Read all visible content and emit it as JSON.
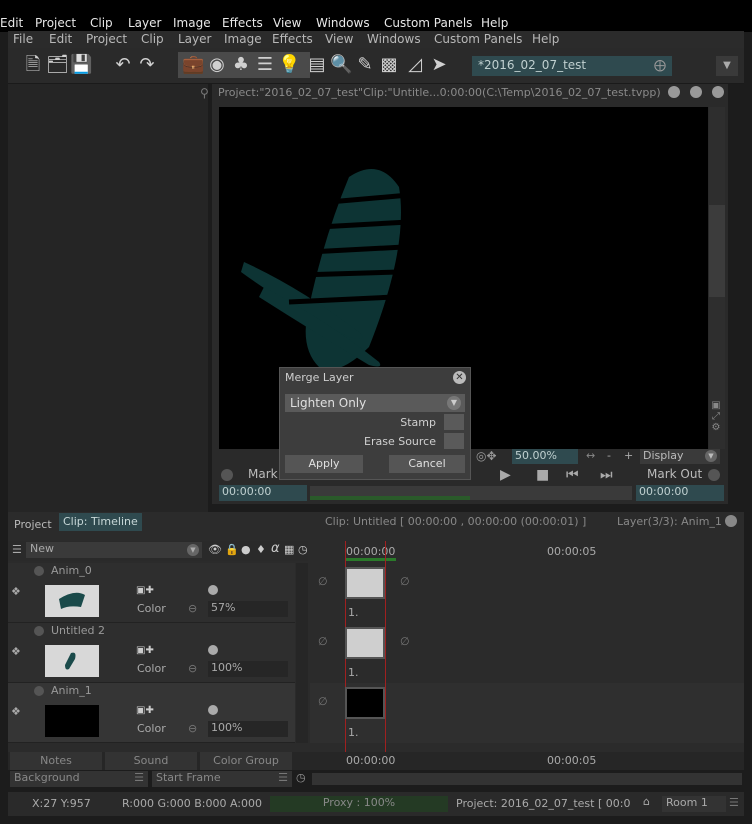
{
  "menu_outer": [
    "Edit",
    "Project",
    "Clip",
    "Layer",
    "Image",
    "Effects",
    "View",
    "Windows",
    "Custom Panels",
    "Help"
  ],
  "menu_inner": [
    "File",
    "Edit",
    "Project",
    "Clip",
    "Layer",
    "Image",
    "Effects",
    "View",
    "Windows",
    "Custom Panels",
    "Help"
  ],
  "project_field": "*2016_02_07_test",
  "viewer_title": "Project:\"2016_02_07_test\"Clip:\"Untitle...0:00:00(C:\\Temp\\2016_02_07_test.tvpp)",
  "dialog": {
    "title": "Merge Layer",
    "mode": "Lighten Only",
    "stamp_label": "Stamp",
    "erase_label": "Erase Source",
    "apply": "Apply",
    "cancel": "Cancel"
  },
  "transport": {
    "zoom": "50.00%",
    "display": "Display",
    "mark_in": "Mark In",
    "mark_out": "Mark Out",
    "time_in": "00:00:00",
    "time_out": "00:00:00",
    "minus": "-",
    "plus": "+"
  },
  "timeline": {
    "tab_project": "Project",
    "tab_clip": "Clip: Timeline",
    "clip_info": "Clip: Untitled [ 00:00:00 , 00:00:00  (00:00:01) ]",
    "layer_info": "Layer(3/3): Anim_1",
    "new_label": "New",
    "time_start": "00:00:00",
    "time_5": "00:00:05",
    "layers": [
      {
        "name": "Anim_0",
        "color_label": "Color",
        "opacity": "57%",
        "frame": "1."
      },
      {
        "name": "Untitled 2",
        "color_label": "Color",
        "opacity": "100%",
        "frame": "1."
      },
      {
        "name": "Anim_1",
        "color_label": "Color",
        "opacity": "100%",
        "frame": "1."
      }
    ],
    "bottom_tabs": [
      "Notes",
      "Sound",
      "Color Group"
    ],
    "background": "Background",
    "start_frame": "Start Frame",
    "bottom_time_start": "00:00:00",
    "bottom_time_5": "00:00:05"
  },
  "status": {
    "coords": "X:27  Y:957",
    "rgba": "R:000 G:000 B:000 A:000",
    "proxy": "Proxy : 100%",
    "project": "Project: 2016_02_07_test [ 00:0",
    "room": "Room 1"
  },
  "colors": {
    "accent": "#2f4a4f",
    "stroke": "#0f3a3a",
    "green": "#2a5a2a"
  }
}
